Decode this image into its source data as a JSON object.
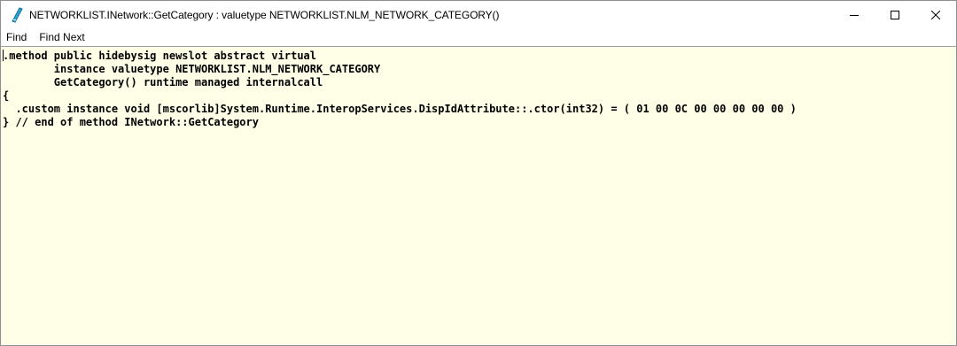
{
  "window": {
    "title": "NETWORKLIST.INetwork::GetCategory : valuetype NETWORKLIST.NLM_NETWORK_CATEGORY()",
    "icon": "il-method-icon",
    "controls": [
      "minimize-icon",
      "maximize-icon",
      "close-icon"
    ]
  },
  "menu": {
    "find_label": "Find",
    "find_next_label": "Find Next"
  },
  "editor": {
    "background": "#ffffe7",
    "lines": [
      ".method public hidebysig newslot abstract virtual",
      "        instance valuetype NETWORKLIST.NLM_NETWORK_CATEGORY",
      "        GetCategory() runtime managed internalcall",
      "{",
      "  .custom instance void [mscorlib]System.Runtime.InteropServices.DispIdAttribute::.ctor(int32) = ( 01 00 0C 00 00 00 00 00 )",
      "} // end of method INetwork::GetCategory"
    ]
  }
}
